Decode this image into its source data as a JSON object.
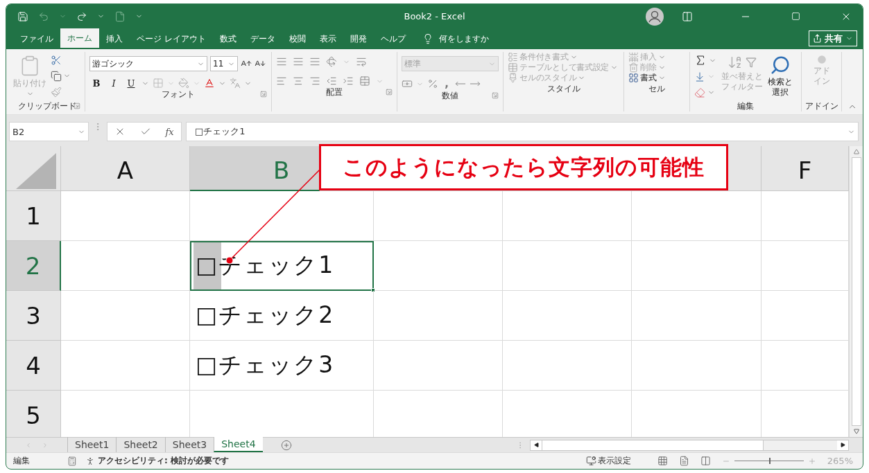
{
  "window": {
    "title": "Book2  -  Excel"
  },
  "ribbon_tabs": [
    {
      "label": "ファイル",
      "selected": false
    },
    {
      "label": "ホーム",
      "selected": true
    },
    {
      "label": "挿入",
      "selected": false
    },
    {
      "label": "ページ レイアウト",
      "selected": false
    },
    {
      "label": "数式",
      "selected": false
    },
    {
      "label": "データ",
      "selected": false
    },
    {
      "label": "校閲",
      "selected": false
    },
    {
      "label": "表示",
      "selected": false
    },
    {
      "label": "開発",
      "selected": false
    },
    {
      "label": "ヘルプ",
      "selected": false
    }
  ],
  "tell_me": {
    "placeholder": "何をしますか"
  },
  "share_button": {
    "label": "共有"
  },
  "ribbon": {
    "clipboard": {
      "label": "クリップボード",
      "paste": {
        "label": "貼り付け",
        "disabled": true
      }
    },
    "font": {
      "label": "フォント",
      "font_name": "游ゴシック",
      "font_size": "11",
      "style_buttons": [
        "B",
        "I",
        "U"
      ]
    },
    "alignment": {
      "label": "配置"
    },
    "number": {
      "label": "数値",
      "format": {
        "value": "標準",
        "disabled": true
      },
      "comma": ","
    },
    "styles": {
      "label": "スタイル",
      "items": [
        {
          "label": "条件付き書式",
          "disabled": true
        },
        {
          "label": "テーブルとして書式設定",
          "disabled": true
        },
        {
          "label": "セルのスタイル",
          "disabled": true
        }
      ]
    },
    "cells": {
      "label": "セル",
      "items": [
        {
          "label": "挿入",
          "disabled": true
        },
        {
          "label": "削除",
          "disabled": true
        },
        {
          "label": "書式",
          "disabled": false
        }
      ]
    },
    "editing": {
      "label": "編集",
      "items": [
        {
          "label": "並べ替えとフィルター",
          "disabled": true
        },
        {
          "label": "検索と選択",
          "disabled": false
        }
      ]
    },
    "addins": {
      "label": "アドイン",
      "button": {
        "label": "アドイン",
        "disabled": true
      }
    }
  },
  "formula_bar": {
    "name_box": "B2",
    "function_label": "fx",
    "value": "□チェック1"
  },
  "grid": {
    "columns": [
      {
        "label": "A",
        "selected": false
      },
      {
        "label": "B",
        "selected": true
      },
      {
        "label": "F",
        "selected": false
      }
    ],
    "rows": [
      {
        "label": "1",
        "selected": false
      },
      {
        "label": "2",
        "selected": true,
        "column_b": {
          "text": "□チェック1",
          "active": true,
          "box_highlighted": true
        }
      },
      {
        "label": "3",
        "selected": false,
        "column_b": {
          "text": "□チェック2",
          "active": false,
          "box_highlighted": false
        }
      },
      {
        "label": "4",
        "selected": false,
        "column_b": {
          "text": "□チェック3",
          "active": false,
          "box_highlighted": false
        }
      },
      {
        "label": "5",
        "selected": false
      }
    ]
  },
  "callout": {
    "text": "このようになったら文字列の可能性"
  },
  "sheet_tabs": [
    {
      "label": "Sheet1",
      "selected": false
    },
    {
      "label": "Sheet2",
      "selected": false
    },
    {
      "label": "Sheet3",
      "selected": false
    },
    {
      "label": "Sheet4",
      "selected": true
    }
  ],
  "status_bar": {
    "mode": "編集",
    "accessibility": "アクセシビリティ: 検討が必要です",
    "display_settings": "表示設定",
    "zoom": {
      "level": 0.5,
      "reading": "265%"
    }
  }
}
